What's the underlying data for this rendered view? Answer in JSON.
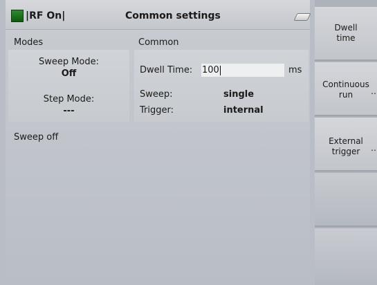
{
  "header": {
    "rf_status": "|RF On|",
    "title": "Common settings"
  },
  "modes": {
    "heading": "Modes",
    "sweep_mode_label": "Sweep Mode:",
    "sweep_mode_value": "Off",
    "step_mode_label": "Step Mode:",
    "step_mode_value": "---"
  },
  "common": {
    "heading": "Common",
    "dwell_time_label": "Dwell Time:",
    "dwell_time_value": "100",
    "dwell_time_unit": "ms",
    "sweep_label": "Sweep:",
    "sweep_value": "single",
    "trigger_label": "Trigger:",
    "trigger_value": "internal"
  },
  "status": "Sweep off",
  "softkeys": [
    {
      "line1": "Dwell",
      "line2": "time",
      "more": ""
    },
    {
      "line1": "Continuous",
      "line2": "run",
      "more": "‥"
    },
    {
      "line1": "External",
      "line2": "trigger",
      "more": "‥"
    },
    {
      "line1": "",
      "line2": "",
      "more": ""
    },
    {
      "line1": "",
      "line2": "",
      "more": ""
    }
  ],
  "colors": {
    "rf_indicator": "#1e7a1e",
    "background": "#c2c6cc"
  }
}
